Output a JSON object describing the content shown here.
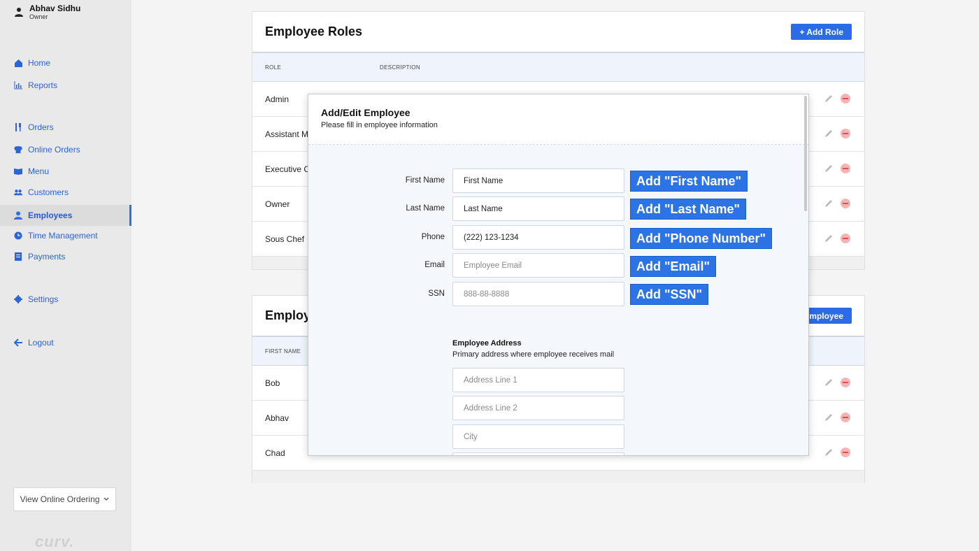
{
  "user": {
    "name": "Abhav Sidhu",
    "role": "Owner"
  },
  "nav": {
    "home": "Home",
    "reports": "Reports",
    "orders": "Orders",
    "online_orders": "Online Orders",
    "menu": "Menu",
    "customers": "Customers",
    "employees": "Employees",
    "time_management": "Time Management",
    "payments": "Payments",
    "settings": "Settings",
    "logout": "Logout"
  },
  "view_online_ordering": "View Online Ordering",
  "logo": "curv.",
  "roles_card": {
    "title": "Employee Roles",
    "add_button": "+ Add Role",
    "columns": [
      "ROLE",
      "DESCRIPTION"
    ],
    "rows": [
      "Admin",
      "Assistant M",
      "Executive C",
      "Owner",
      "Sous Chef"
    ]
  },
  "employees_card": {
    "title": "Employe",
    "add_button": "Employee",
    "columns": [
      "FIRST NAME"
    ],
    "rows": [
      "Bob",
      "Abhav",
      "Chad"
    ]
  },
  "modal": {
    "title": "Add/Edit Employee",
    "subtitle": "Please fill in employee information",
    "fields": [
      {
        "label": "First Name",
        "value": "First Name",
        "placeholder": "",
        "callout": "Add \"First Name\""
      },
      {
        "label": "Last Name",
        "value": "Last Name",
        "placeholder": "",
        "callout": "Add \"Last Name\""
      },
      {
        "label": "Phone",
        "value": "(222) 123-1234",
        "placeholder": "",
        "callout": "Add \"Phone Number\""
      },
      {
        "label": "Email",
        "value": "",
        "placeholder": "Employee Email",
        "callout": "Add \"Email\""
      },
      {
        "label": "SSN",
        "value": "",
        "placeholder": "888-88-8888",
        "callout": "Add \"SSN\""
      }
    ],
    "address": {
      "title": "Employee Address",
      "subtitle": "Primary address where employee receives mail",
      "line1_placeholder": "Address Line 1",
      "line2_placeholder": "Address Line 2",
      "city_placeholder": "City"
    }
  },
  "colors": {
    "accent": "#2b6be6",
    "callout": "#2c74e6",
    "sidebar_bg": "#e9e9e9",
    "delete": "#e0504f"
  }
}
